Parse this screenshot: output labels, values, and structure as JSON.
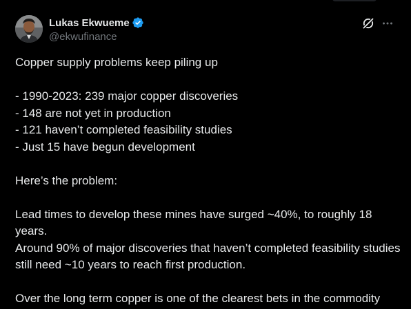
{
  "author": {
    "display_name": "Lukas Ekwueme",
    "handle": "@ekwufinance",
    "verified": true
  },
  "icons": {
    "verified": "verified-badge-icon",
    "grok": "grok-icon",
    "more": "more-options-icon"
  },
  "colors": {
    "background": "#000000",
    "text_primary": "#e7e9ea",
    "text_secondary": "#71767b",
    "verified_blue": "#1d9bf0"
  },
  "tweet": {
    "line_01": "Copper supply problems keep piling up",
    "line_02": "- 1990-2023: 239 major copper discoveries",
    "line_03": "- 148 are not yet in production",
    "line_04": "- 121 haven’t completed feasibility studies",
    "line_05": "- Just 15 have begun development",
    "line_06": "Here’s the problem:",
    "line_07": "Lead times to develop these mines have surged ~40%, to roughly 18 years.",
    "line_08": "Around 90% of major discoveries that haven’t completed feasibility studies still need ~10 years to reach first production.",
    "line_09": "Over the long term copper is one of the clearest bets in the commodity universe."
  }
}
